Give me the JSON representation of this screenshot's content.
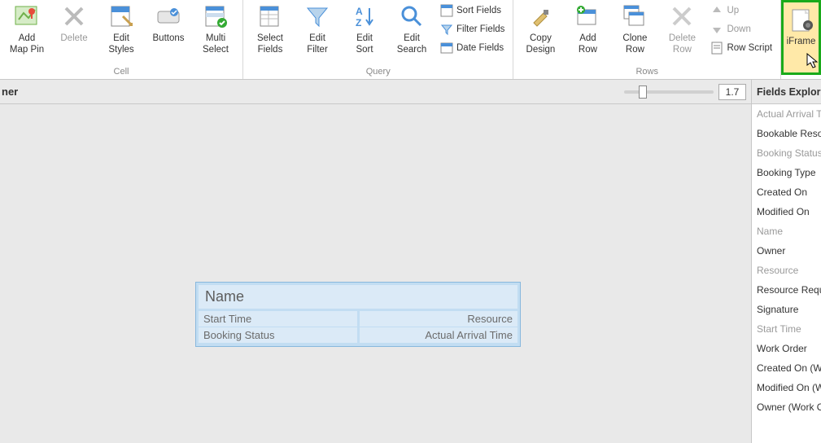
{
  "ribbon": {
    "groups": {
      "cell": {
        "label": "Cell",
        "buttons": {
          "addMapPin": "Add\nMap Pin",
          "delete": "Delete",
          "editStyles": "Edit\nStyles",
          "buttons": "Buttons",
          "multiSelect": "Multi\nSelect"
        }
      },
      "query": {
        "label": "Query",
        "buttons": {
          "selectFields": "Select\nFields",
          "editFilter": "Edit\nFilter",
          "editSort": "Edit\nSort",
          "editSearch": "Edit\nSearch",
          "sortFields": "Sort Fields",
          "filterFields": "Filter Fields",
          "dateFields": "Date Fields"
        }
      },
      "rows": {
        "label": "Rows",
        "buttons": {
          "copyDesign": "Copy\nDesign",
          "addRow": "Add\nRow",
          "cloneRow": "Clone\nRow",
          "deleteRow": "Delete\nRow",
          "up": "Up",
          "down": "Down",
          "rowScript": "Row Script"
        }
      },
      "iframe": {
        "label": "iFrame"
      }
    }
  },
  "designerBar": {
    "label": "ner",
    "zoom": "1.7"
  },
  "template": {
    "title": "Name",
    "rows": [
      {
        "left": "Start Time",
        "right": "Resource"
      },
      {
        "left": "Booking Status",
        "right": "Actual Arrival Time"
      }
    ]
  },
  "fieldsExplorer": {
    "title": "Fields Explorer",
    "items": [
      {
        "label": "Actual Arrival Time",
        "disabled": true
      },
      {
        "label": "Bookable Resource",
        "disabled": false
      },
      {
        "label": "Booking Status",
        "disabled": true
      },
      {
        "label": "Booking Type",
        "disabled": false
      },
      {
        "label": "Created On",
        "disabled": false
      },
      {
        "label": "Modified On",
        "disabled": false
      },
      {
        "label": "Name",
        "disabled": true
      },
      {
        "label": "Owner",
        "disabled": false
      },
      {
        "label": "Resource",
        "disabled": true
      },
      {
        "label": "Resource Requirement",
        "disabled": false
      },
      {
        "label": "Signature",
        "disabled": false
      },
      {
        "label": "Start Time",
        "disabled": true
      },
      {
        "label": "Work Order",
        "disabled": false
      },
      {
        "label": "Created On (Work Order)",
        "disabled": false
      },
      {
        "label": "Modified On (Work Order)",
        "disabled": false
      },
      {
        "label": "Owner (Work Order)",
        "disabled": false
      }
    ]
  }
}
